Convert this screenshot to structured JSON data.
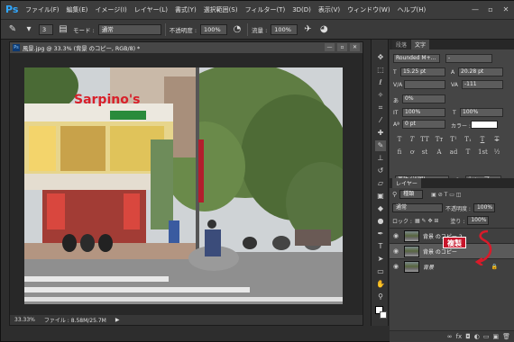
{
  "app": {
    "logo": "Ps"
  },
  "menu": [
    "ファイル(F)",
    "編集(E)",
    "イメージ(I)",
    "レイヤー(L)",
    "書式(Y)",
    "選択範囲(S)",
    "フィルター(T)",
    "3D(D)",
    "表示(V)",
    "ウィンドウ(W)",
    "ヘルプ(H)"
  ],
  "window_controls": {
    "minimize": "—",
    "restore": "▫",
    "close": "✕"
  },
  "options": {
    "brush_size": "3",
    "mode_label": "モード :",
    "mode_value": "通常",
    "opacity_label": "不透明度 :",
    "opacity_value": "100%",
    "flow_label": "流量 :",
    "flow_value": "100%"
  },
  "document": {
    "tab_title": "風景.jpg @ 33.3% (背景 のコピー, RGB/8) *",
    "zoom": "33.33%",
    "file_info": "ファイル : 8.58M/25.7M",
    "store_sign": "Sarpino's"
  },
  "character_panel": {
    "tabs": [
      "段落",
      "文字"
    ],
    "font_family": "Rounded M+...",
    "font_style": "-",
    "font_size": "15.25 pt",
    "leading": "20.28 pt",
    "tracking": "-111",
    "kerning": "0%",
    "vscale": "100%",
    "hscale": "100%",
    "baseline": "0 pt",
    "color_label": "カラー :",
    "language": "英語 (米国)",
    "antialias": "シャープ",
    "type_buttons": [
      "T",
      "T",
      "TT",
      "Tт",
      "T¹",
      "T₁",
      "T",
      "T"
    ],
    "ligature_buttons": [
      "fi",
      "ơ",
      "st",
      "A",
      "ad",
      "T",
      "1st",
      "½"
    ]
  },
  "layers_panel": {
    "tab": "レイヤー",
    "filter": "種類",
    "blend_mode": "通常",
    "opacity_label": "不透明度 :",
    "opacity_value": "100%",
    "lock_label": "ロック :",
    "fill_label": "塗り :",
    "fill_value": "100%",
    "layers": [
      {
        "name": "背景 のコピー 2"
      },
      {
        "name": "背景 のコピー"
      },
      {
        "name": "背景"
      }
    ],
    "annotation": "複製"
  }
}
